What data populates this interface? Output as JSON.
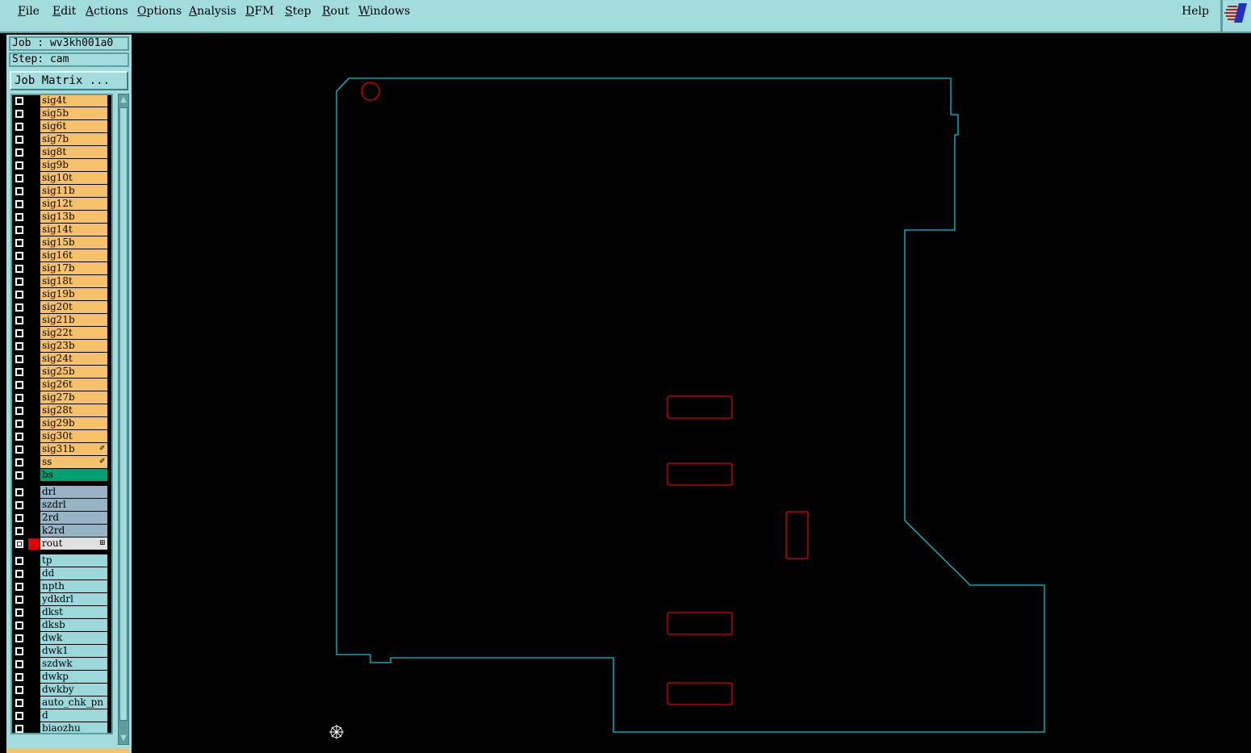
{
  "menubar": {
    "items": [
      {
        "name": "file",
        "label": "File",
        "mn": "F",
        "rest": "ile"
      },
      {
        "name": "edit",
        "label": "Edit",
        "mn": "E",
        "rest": "dit"
      },
      {
        "name": "actions",
        "label": "Actions",
        "mn": "A",
        "rest": "ctions"
      },
      {
        "name": "options",
        "label": "Options",
        "mn": "O",
        "rest": "ptions"
      },
      {
        "name": "analysis",
        "label": "Analysis",
        "mn": "A",
        "rest": "nalysis"
      },
      {
        "name": "dfm",
        "label": "DFM",
        "mn": "D",
        "rest": "FM"
      },
      {
        "name": "step",
        "label": "Step",
        "mn": "S",
        "rest": "tep"
      },
      {
        "name": "rout",
        "label": "Rout",
        "mn": "R",
        "rest": "out"
      },
      {
        "name": "windows",
        "label": "Windows",
        "mn": "W",
        "rest": "indows"
      }
    ],
    "help": "Help"
  },
  "panel": {
    "job": "Job : wv3kh001a0",
    "step": "Step: cam",
    "job_matrix": "Job Matrix ..."
  },
  "colors": {
    "signal": "#f5c26b",
    "solder": "#00a070",
    "drill": "#96b4c3",
    "rout_bg": "#e0e0e0",
    "misc": "#9ad8dc",
    "profile": "#00c8d2",
    "features": "#e00000"
  },
  "layers": [
    {
      "name": "sig4t",
      "kind": "signal"
    },
    {
      "name": "sig5b",
      "kind": "signal"
    },
    {
      "name": "sig6t",
      "kind": "signal"
    },
    {
      "name": "sig7b",
      "kind": "signal"
    },
    {
      "name": "sig8t",
      "kind": "signal"
    },
    {
      "name": "sig9b",
      "kind": "signal"
    },
    {
      "name": "sig10t",
      "kind": "signal"
    },
    {
      "name": "sig11b",
      "kind": "signal"
    },
    {
      "name": "sig12t",
      "kind": "signal"
    },
    {
      "name": "sig13b",
      "kind": "signal"
    },
    {
      "name": "sig14t",
      "kind": "signal"
    },
    {
      "name": "sig15b",
      "kind": "signal"
    },
    {
      "name": "sig16t",
      "kind": "signal"
    },
    {
      "name": "sig17b",
      "kind": "signal"
    },
    {
      "name": "sig18t",
      "kind": "signal"
    },
    {
      "name": "sig19b",
      "kind": "signal"
    },
    {
      "name": "sig20t",
      "kind": "signal"
    },
    {
      "name": "sig21b",
      "kind": "signal"
    },
    {
      "name": "sig22t",
      "kind": "signal"
    },
    {
      "name": "sig23b",
      "kind": "signal"
    },
    {
      "name": "sig24t",
      "kind": "signal"
    },
    {
      "name": "sig25b",
      "kind": "signal"
    },
    {
      "name": "sig26t",
      "kind": "signal"
    },
    {
      "name": "sig27b",
      "kind": "signal"
    },
    {
      "name": "sig28t",
      "kind": "signal"
    },
    {
      "name": "sig29b",
      "kind": "signal"
    },
    {
      "name": "sig30t",
      "kind": "signal"
    },
    {
      "name": "sig31b",
      "kind": "signal",
      "mark": "✐"
    },
    {
      "name": "ss",
      "kind": "signal",
      "mark": "✐"
    },
    {
      "name": "bs",
      "kind": "solder"
    },
    {
      "name": "drl",
      "kind": "drill",
      "gap": true
    },
    {
      "name": "szdrl",
      "kind": "drill"
    },
    {
      "name": "2rd",
      "kind": "drill"
    },
    {
      "name": "k2rd",
      "kind": "drill"
    },
    {
      "name": "rout",
      "kind": "rout",
      "checked": true,
      "mark": "⊞"
    },
    {
      "name": "tp",
      "kind": "misc",
      "gap": true
    },
    {
      "name": "dd",
      "kind": "misc"
    },
    {
      "name": "npth",
      "kind": "misc"
    },
    {
      "name": "ydkdrl",
      "kind": "misc"
    },
    {
      "name": "dkst",
      "kind": "misc"
    },
    {
      "name": "dksb",
      "kind": "misc"
    },
    {
      "name": "dwk",
      "kind": "misc"
    },
    {
      "name": "dwk1",
      "kind": "misc"
    },
    {
      "name": "szdwk",
      "kind": "misc"
    },
    {
      "name": "dwkp",
      "kind": "misc"
    },
    {
      "name": "dwkby",
      "kind": "misc"
    },
    {
      "name": "auto_chk_pn",
      "kind": "misc"
    },
    {
      "name": "d",
      "kind": "misc"
    },
    {
      "name": "biaozhu",
      "kind": "misc"
    }
  ]
}
